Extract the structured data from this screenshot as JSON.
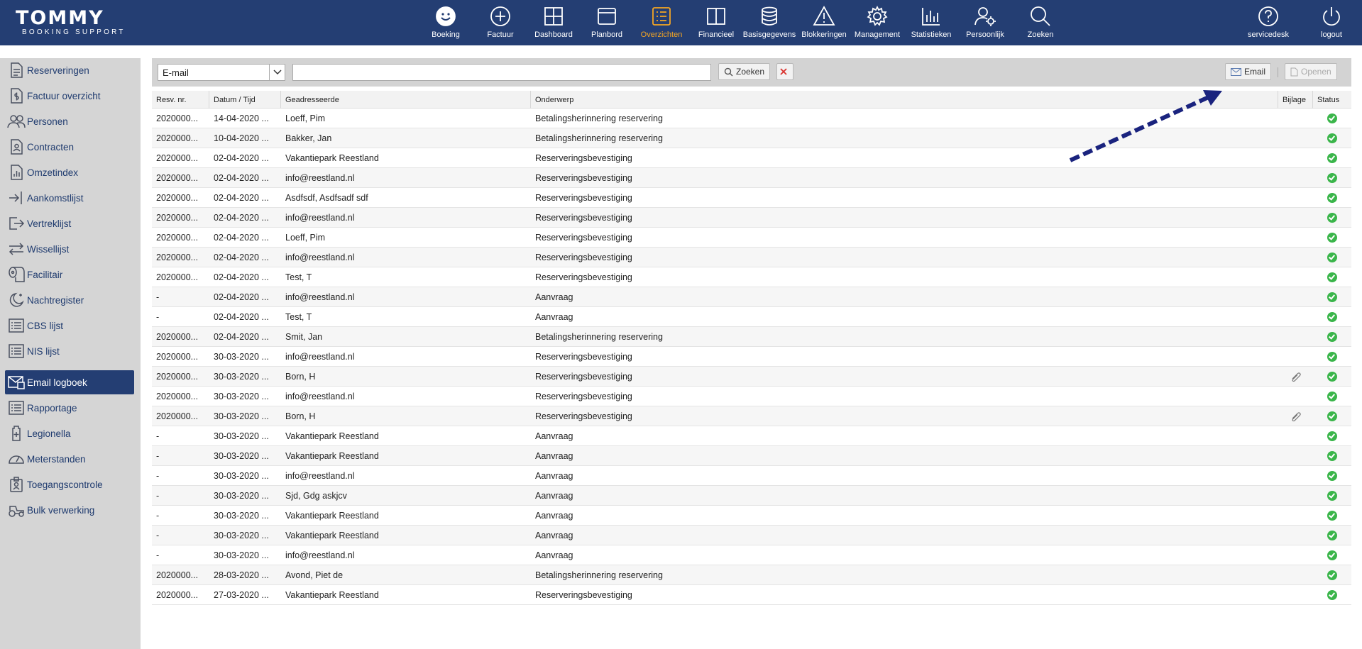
{
  "header": {
    "logo_main": "TOMMY",
    "logo_sub": "BOOKING SUPPORT",
    "nav": [
      {
        "label": "Boeking",
        "icon": "smiley-icon"
      },
      {
        "label": "Factuur",
        "icon": "plus-circle-icon"
      },
      {
        "label": "Dashboard",
        "icon": "grid-icon"
      },
      {
        "label": "Planbord",
        "icon": "window-icon"
      },
      {
        "label": "Overzichten",
        "icon": "list-icon",
        "active": true
      },
      {
        "label": "Financieel",
        "icon": "book-icon"
      },
      {
        "label": "Basisgegevens",
        "icon": "database-icon"
      },
      {
        "label": "Blokkeringen",
        "icon": "warning-icon"
      },
      {
        "label": "Management",
        "icon": "gear-icon"
      },
      {
        "label": "Statistieken",
        "icon": "bar-chart-icon"
      },
      {
        "label": "Persoonlijk",
        "icon": "user-gear-icon"
      },
      {
        "label": "Zoeken",
        "icon": "search-icon"
      }
    ],
    "right": [
      {
        "label": "servicedesk",
        "icon": "help-icon"
      },
      {
        "label": "logout",
        "icon": "power-icon"
      }
    ],
    "accent": "#f5a623",
    "bar_color": "#243e73"
  },
  "sidebar": {
    "items": [
      {
        "label": "Reserveringen",
        "icon": "document-icon"
      },
      {
        "label": "Factuur overzicht",
        "icon": "invoice-icon"
      },
      {
        "label": "Personen",
        "icon": "people-icon"
      },
      {
        "label": "Contracten",
        "icon": "contract-icon"
      },
      {
        "label": "Omzetindex",
        "icon": "chart-doc-icon"
      },
      {
        "label": "Aankomstlijst",
        "icon": "arrive-icon"
      },
      {
        "label": "Vertreklijst",
        "icon": "depart-icon"
      },
      {
        "label": "Wissellijst",
        "icon": "swap-icon"
      },
      {
        "label": "Facilitair",
        "icon": "toilet-paper-icon"
      },
      {
        "label": "Nachtregister",
        "icon": "moon-icon"
      },
      {
        "label": "CBS lijst",
        "icon": "list-icon"
      },
      {
        "label": "NIS lijst",
        "icon": "list-icon"
      },
      {
        "label": "Email logboek",
        "icon": "email-log-icon",
        "active": true
      },
      {
        "label": "Rapportage",
        "icon": "list-icon"
      },
      {
        "label": "Legionella",
        "icon": "bottle-icon"
      },
      {
        "label": "Meterstanden",
        "icon": "gauge-icon"
      },
      {
        "label": "Toegangscontrole",
        "icon": "badge-icon"
      },
      {
        "label": "Bulk verwerking",
        "icon": "tractor-icon"
      }
    ]
  },
  "toolbar": {
    "filter_value": "E-mail",
    "search_value": "",
    "search_label": "Zoeken",
    "email_label": "Email",
    "open_label": "Openen"
  },
  "table": {
    "columns": [
      "Resv. nr.",
      "Datum / Tijd",
      "Geadresseerde",
      "Onderwerp",
      "Bijlage",
      "Status"
    ],
    "rows": [
      {
        "resv": "2020000...",
        "date": "14-04-2020 ...",
        "to": "Loeff, Pim",
        "subject": "Betalingsherinnering reservering",
        "attach": false,
        "status": "ok"
      },
      {
        "resv": "2020000...",
        "date": "10-04-2020 ...",
        "to": "Bakker, Jan",
        "subject": "Betalingsherinnering reservering",
        "attach": false,
        "status": "ok"
      },
      {
        "resv": "2020000...",
        "date": "02-04-2020 ...",
        "to": "Vakantiepark Reestland",
        "subject": "Reserveringsbevestiging",
        "attach": false,
        "status": "ok"
      },
      {
        "resv": "2020000...",
        "date": "02-04-2020 ...",
        "to": "info@reestland.nl",
        "subject": "Reserveringsbevestiging",
        "attach": false,
        "status": "ok"
      },
      {
        "resv": "2020000...",
        "date": "02-04-2020 ...",
        "to": "Asdfsdf, Asdfsadf sdf",
        "subject": "Reserveringsbevestiging",
        "attach": false,
        "status": "ok"
      },
      {
        "resv": "2020000...",
        "date": "02-04-2020 ...",
        "to": "info@reestland.nl",
        "subject": "Reserveringsbevestiging",
        "attach": false,
        "status": "ok"
      },
      {
        "resv": "2020000...",
        "date": "02-04-2020 ...",
        "to": "Loeff, Pim",
        "subject": "Reserveringsbevestiging",
        "attach": false,
        "status": "ok"
      },
      {
        "resv": "2020000...",
        "date": "02-04-2020 ...",
        "to": "info@reestland.nl",
        "subject": "Reserveringsbevestiging",
        "attach": false,
        "status": "ok"
      },
      {
        "resv": "2020000...",
        "date": "02-04-2020 ...",
        "to": "Test, T",
        "subject": "Reserveringsbevestiging",
        "attach": false,
        "status": "ok"
      },
      {
        "resv": "-",
        "date": "02-04-2020 ...",
        "to": "info@reestland.nl",
        "subject": "Aanvraag",
        "attach": false,
        "status": "ok"
      },
      {
        "resv": "-",
        "date": "02-04-2020 ...",
        "to": "Test, T",
        "subject": "Aanvraag",
        "attach": false,
        "status": "ok"
      },
      {
        "resv": "2020000...",
        "date": "02-04-2020 ...",
        "to": "Smit, Jan",
        "subject": "Betalingsherinnering reservering",
        "attach": false,
        "status": "ok"
      },
      {
        "resv": "2020000...",
        "date": "30-03-2020 ...",
        "to": "info@reestland.nl",
        "subject": "Reserveringsbevestiging",
        "attach": false,
        "status": "ok"
      },
      {
        "resv": "2020000...",
        "date": "30-03-2020 ...",
        "to": "Born, H",
        "subject": "Reserveringsbevestiging",
        "attach": true,
        "status": "ok"
      },
      {
        "resv": "2020000...",
        "date": "30-03-2020 ...",
        "to": "info@reestland.nl",
        "subject": "Reserveringsbevestiging",
        "attach": false,
        "status": "ok"
      },
      {
        "resv": "2020000...",
        "date": "30-03-2020 ...",
        "to": "Born, H",
        "subject": "Reserveringsbevestiging",
        "attach": true,
        "status": "ok"
      },
      {
        "resv": "-",
        "date": "30-03-2020 ...",
        "to": "Vakantiepark Reestland",
        "subject": "Aanvraag",
        "attach": false,
        "status": "ok"
      },
      {
        "resv": "-",
        "date": "30-03-2020 ...",
        "to": "Vakantiepark Reestland",
        "subject": "Aanvraag",
        "attach": false,
        "status": "ok"
      },
      {
        "resv": "-",
        "date": "30-03-2020 ...",
        "to": "info@reestland.nl",
        "subject": "Aanvraag",
        "attach": false,
        "status": "ok"
      },
      {
        "resv": "-",
        "date": "30-03-2020 ...",
        "to": "Sjd, Gdg askjcv",
        "subject": "Aanvraag",
        "attach": false,
        "status": "ok"
      },
      {
        "resv": "-",
        "date": "30-03-2020 ...",
        "to": "Vakantiepark Reestland",
        "subject": "Aanvraag",
        "attach": false,
        "status": "ok"
      },
      {
        "resv": "-",
        "date": "30-03-2020 ...",
        "to": "Vakantiepark Reestland",
        "subject": "Aanvraag",
        "attach": false,
        "status": "ok"
      },
      {
        "resv": "-",
        "date": "30-03-2020 ...",
        "to": "info@reestland.nl",
        "subject": "Aanvraag",
        "attach": false,
        "status": "ok"
      },
      {
        "resv": "2020000...",
        "date": "28-03-2020 ...",
        "to": "Avond, Piet de",
        "subject": "Betalingsherinnering reservering",
        "attach": false,
        "status": "ok"
      },
      {
        "resv": "2020000...",
        "date": "27-03-2020 ...",
        "to": "Vakantiepark Reestland",
        "subject": "Reserveringsbevestiging",
        "attach": false,
        "status": "ok"
      }
    ]
  }
}
